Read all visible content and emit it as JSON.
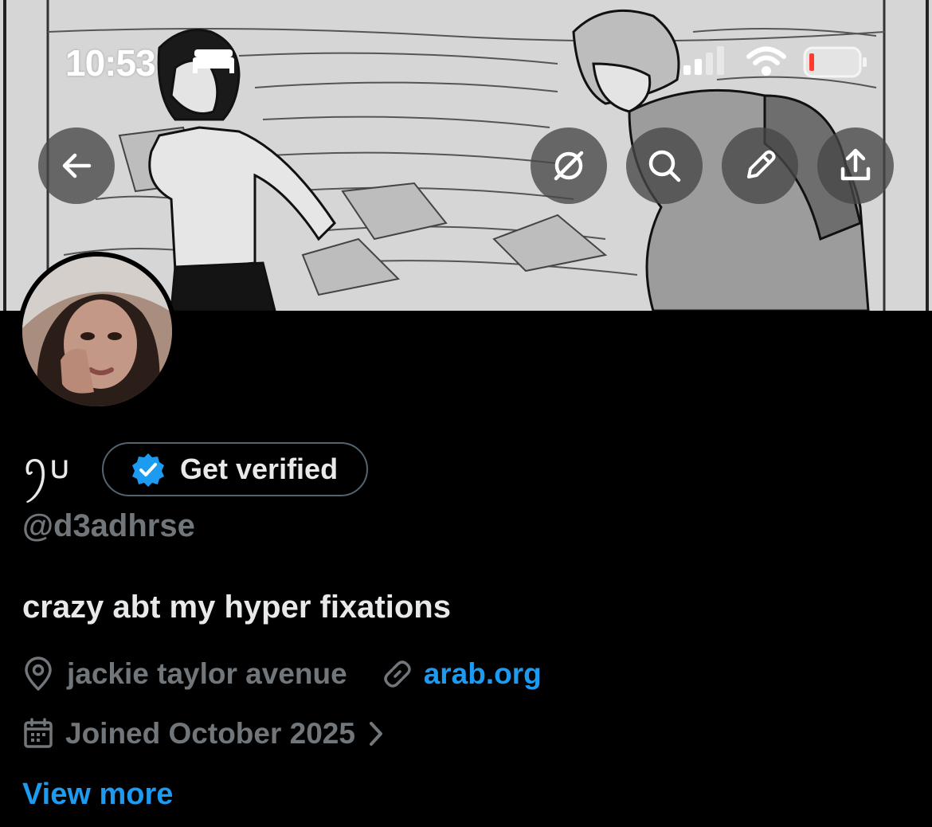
{
  "status_bar": {
    "time": "10:53",
    "icons": [
      "sleep-bed-icon",
      "cellular-signal-icon",
      "wifi-icon",
      "battery-low-icon"
    ],
    "battery_color": "#ff3b30"
  },
  "header": {
    "buttons": [
      {
        "name": "back-button",
        "icon": "arrow-left-icon"
      },
      {
        "name": "translate-button",
        "icon": "circle-slash-icon"
      },
      {
        "name": "search-button",
        "icon": "search-icon"
      },
      {
        "name": "edit-button",
        "icon": "pencil-icon"
      },
      {
        "name": "share-button",
        "icon": "share-upload-icon"
      }
    ]
  },
  "profile": {
    "display_name": "ꪆ𐓶",
    "verify_label": "Get verified",
    "handle": "@d3adhrse",
    "bio": "crazy abt my hyper fixations",
    "location": "jackie taylor avenue",
    "website": "arab.org",
    "joined": "Joined October 2025",
    "view_more": "View more"
  },
  "colors": {
    "background": "#000000",
    "primary_text": "#e7e9ea",
    "secondary_text": "#71767b",
    "accent_blue": "#1d9bf0",
    "border": "#536471"
  }
}
